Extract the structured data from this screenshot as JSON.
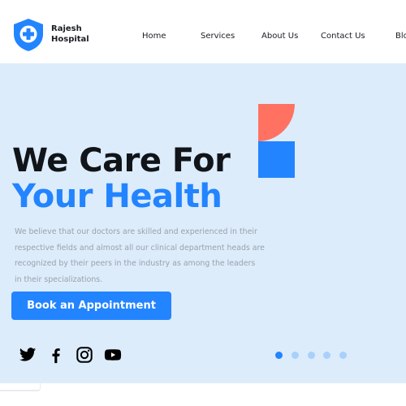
{
  "brand": {
    "line1": "Rajesh",
    "line2": "Hospital",
    "logo_icon": "shield-plus-icon",
    "accent": "#2384ff"
  },
  "nav": {
    "items": [
      {
        "label": "Home"
      },
      {
        "label": "Services"
      },
      {
        "label": "About Us"
      },
      {
        "label": "Contact Us"
      },
      {
        "label": "Blo"
      }
    ]
  },
  "hero": {
    "title_line1": "We Care For",
    "title_line2": "Your Health",
    "description_lines": [
      "We believe that our doctors are skilled and experienced in their",
      "respective fields and almost all our clinical department heads are",
      "recognized by their peers in the industry as among the leaders",
      "in their specializations."
    ],
    "cta_label": "Book an Appointment",
    "background": "#dcecfb",
    "shape_colors": [
      "#ff7262",
      "#2384ff"
    ]
  },
  "social": [
    {
      "icon": "twitter-icon"
    },
    {
      "icon": "facebook-icon"
    },
    {
      "icon": "instagram-icon"
    },
    {
      "icon": "youtube-icon"
    }
  ],
  "carousel": {
    "count": 5,
    "active_index": 0
  }
}
